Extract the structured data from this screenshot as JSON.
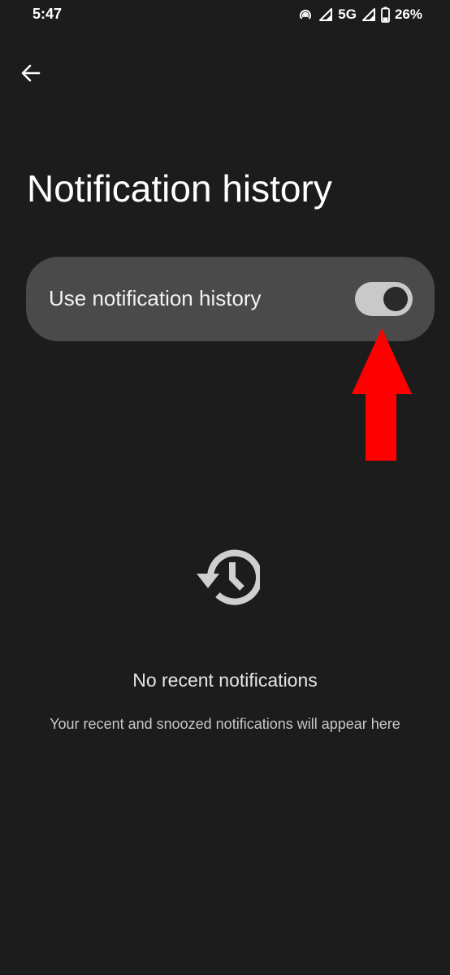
{
  "status_bar": {
    "time": "5:47",
    "network": "5G",
    "battery": "26%",
    "icons": [
      "hotspot-icon",
      "signal-icon",
      "signal-icon",
      "battery-icon"
    ]
  },
  "header": {
    "back_icon": "arrow-left-icon"
  },
  "page": {
    "title": "Notification history"
  },
  "main_toggle": {
    "label": "Use notification history",
    "state": "on",
    "switch_color": "#c9c9c9",
    "card_color": "#4a4a4a"
  },
  "annotation": {
    "arrow_color": "#ff0000",
    "arrow_icon": "red-arrow-up-icon"
  },
  "empty_state": {
    "icon": "history-icon",
    "title": "No recent notifications",
    "description": "Your recent and snoozed notifications will appear here"
  },
  "colors": {
    "background": "#1c1c1c",
    "text": "#ffffff",
    "muted_text": "#c8c8c8"
  }
}
